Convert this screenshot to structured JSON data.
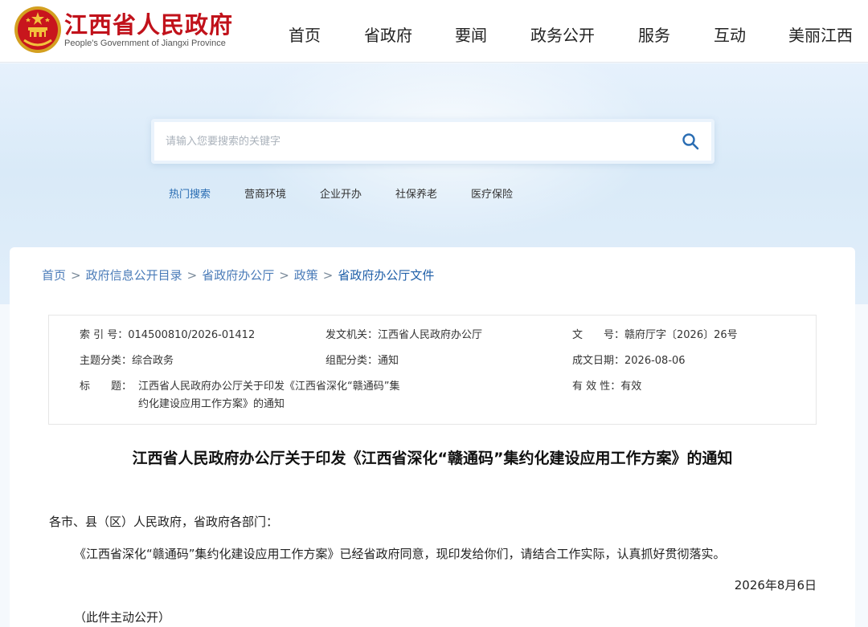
{
  "header": {
    "brand_cn": "江西省人民政府",
    "brand_en": "People's Government of Jiangxi Province",
    "nav": [
      "首页",
      "省政府",
      "要闻",
      "政务公开",
      "服务",
      "互动",
      "美丽江西"
    ]
  },
  "search": {
    "placeholder": "请输入您要搜索的关键字",
    "hot_label": "热门搜索",
    "hot_items": [
      "营商环境",
      "企业开办",
      "社保养老",
      "医疗保险"
    ]
  },
  "breadcrumb": [
    "首页",
    "政府信息公开目录",
    "省政府办公厅",
    "政策",
    "省政府办公厅文件"
  ],
  "meta": {
    "index_label": "索 引 号：",
    "index_value": "014500810/2026-01412",
    "issuer_label": "发文机关：",
    "issuer_value": "江西省人民政府办公厅",
    "docno_label": "文　　号：",
    "docno_value": "赣府厅字〔2026〕26号",
    "topic_label": "主题分类：",
    "topic_value": "综合政务",
    "category_label": "组配分类：",
    "category_value": "通知",
    "date_label": "成文日期：",
    "date_value": "2026-08-06",
    "title_label": "标　　题：",
    "title_value_line1": "江西省人民政府办公厅关于印发《江西省深化“赣通码”集",
    "title_value_line2": "约化建设应用工作方案》的通知",
    "validity_label": "有 效 性：",
    "validity_value": "有效"
  },
  "article": {
    "title": "江西省人民政府办公厅关于印发《江西省深化“赣通码”集约化建设应用工作方案》的通知",
    "salutation": "各市、县（区）人民政府，省政府各部门：",
    "body": "《江西省深化“赣通码”集约化建设应用工作方案》已经省政府同意，现印发给你们，请结合工作实际，认真抓好贯彻落实。",
    "date": "2026年8月6日",
    "note": "（此件主动公开）"
  },
  "colors": {
    "brand_red": "#c1121b",
    "link_blue": "#4a7bb8",
    "hot_blue": "#2a6db3"
  }
}
